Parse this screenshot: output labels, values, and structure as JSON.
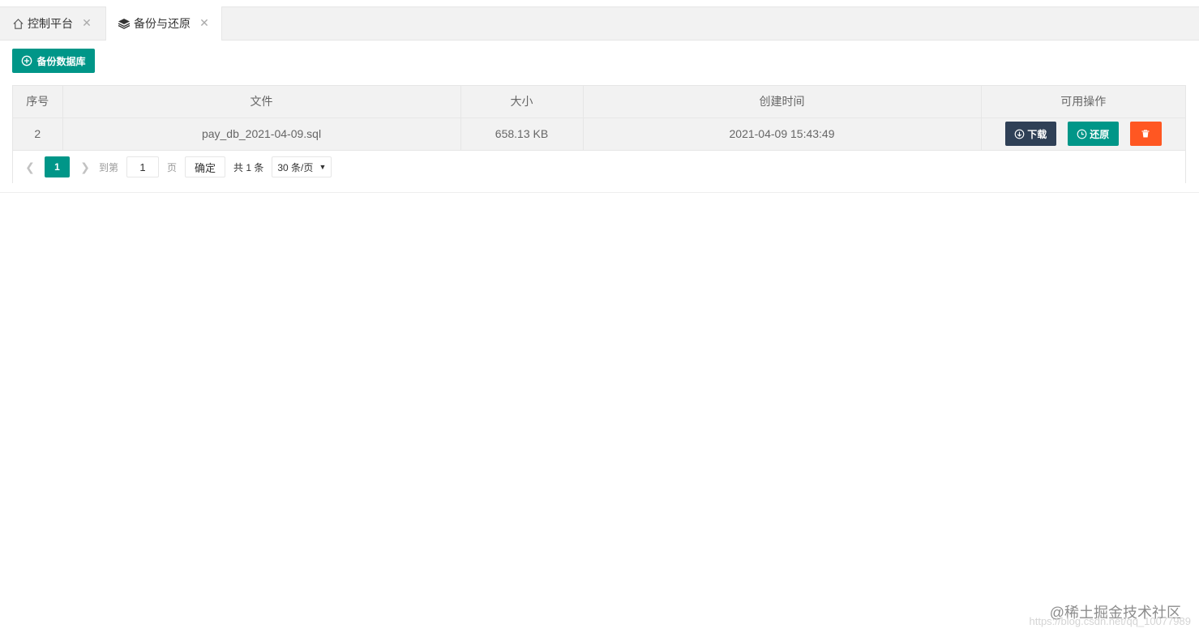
{
  "tabs": [
    {
      "icon": "home-icon",
      "label": "控制平台"
    },
    {
      "icon": "layers-icon",
      "label": "备份与还原",
      "active": true
    }
  ],
  "toolbar": {
    "backup_label": "备份数据库"
  },
  "table": {
    "columns": [
      "序号",
      "文件",
      "大小",
      "创建时间",
      "可用操作"
    ],
    "rows": [
      {
        "index": "2",
        "file": "pay_db_2021-04-09.sql",
        "size": "658.13 KB",
        "created": "2021-04-09 15:43:49"
      }
    ],
    "actions": {
      "download": "下载",
      "restore": "还原"
    }
  },
  "pagination": {
    "current": "1",
    "goto_prefix": "到第",
    "goto_value": "1",
    "goto_suffix": "页",
    "confirm": "确定",
    "total": "共 1 条",
    "limit": "30 条/页"
  },
  "watermark": {
    "site": "@稀土掘金技术社区",
    "url": "https://blog.csdn.net/qq_10077989"
  },
  "colors": {
    "primary": "#009688",
    "dark": "#2f4056",
    "danger": "#ff5722"
  }
}
